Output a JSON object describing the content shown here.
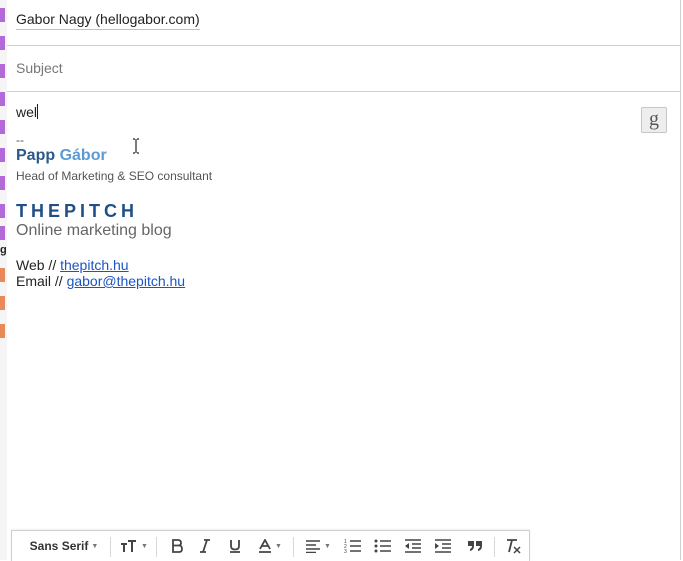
{
  "compose": {
    "recipient": "Gabor Nagy (hellogabor.com)",
    "subject_placeholder": "Subject",
    "body_text": "wel",
    "g_button_glyph": "g"
  },
  "signature": {
    "dashes": "--",
    "first_name": "Papp",
    "last_name": "Gábor",
    "title": "Head of Marketing & SEO consultant",
    "brand": "THEPITCH",
    "tagline": "Online marketing blog",
    "web_label": "Web // ",
    "web_link": "thepitch.hu",
    "email_label": "Email // ",
    "email_link": "gabor@thepitch.hu"
  },
  "left_strip": {
    "letter": "g",
    "marker_colors": [
      "#b36ad8",
      "#b36ad8",
      "#b36ad8",
      "#b36ad8",
      "#b36ad8",
      "#b36ad8",
      "#b36ad8",
      "#b36ad8",
      "#b36ad8",
      "#b36ad8",
      "#e8895a",
      "#e8895a",
      "#e8895a"
    ]
  },
  "toolbar": {
    "font_family": "Sans Serif",
    "icons": [
      "font-size-icon",
      "bold-icon",
      "italic-icon",
      "underline-icon",
      "text-color-icon",
      "align-icon",
      "numbered-list-icon",
      "bulleted-list-icon",
      "indent-less-icon",
      "indent-more-icon",
      "quote-icon",
      "remove-formatting-icon"
    ]
  },
  "colors": {
    "name_first": "#2a5a8a",
    "name_last": "#5b9bd5",
    "brand": "#1f4f86",
    "link": "#1a55c4",
    "recipient_underline": "#e8c64a"
  }
}
